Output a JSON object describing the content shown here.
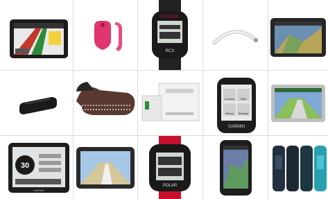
{
  "products": [
    {
      "id": "r1c1",
      "icon": "car-gps-navigator-icon",
      "kind": "device"
    },
    {
      "id": "r1c2",
      "icon": "clip-activity-tracker-icon",
      "kind": "device"
    },
    {
      "id": "r1c3",
      "icon": "sport-watch-icon",
      "kind": "device",
      "brand": "POLAR",
      "model": "RCX"
    },
    {
      "id": "r1c4",
      "icon": "headband-sensor-icon",
      "kind": "device"
    },
    {
      "id": "r1c5",
      "icon": "aviation-gps-icon",
      "kind": "device"
    },
    {
      "id": "r2c1",
      "icon": "usb-tracker-icon",
      "kind": "device"
    },
    {
      "id": "r2c2",
      "icon": "bluetooth-headset-icon",
      "kind": "device"
    },
    {
      "id": "r2c3",
      "icon": "lab-analyzer-icon",
      "kind": "device"
    },
    {
      "id": "r2c4",
      "icon": "bike-computer-icon",
      "kind": "device",
      "brand": "GARMIN",
      "menu": [
        "Courses",
        "Ride",
        "History",
        "Settings"
      ]
    },
    {
      "id": "r2c5",
      "icon": "car-gps-map-icon",
      "kind": "device"
    },
    {
      "id": "r3c1",
      "icon": "dashboard-gps-icon",
      "kind": "device",
      "speed": "30",
      "brand": "GARMIN"
    },
    {
      "id": "r3c2",
      "icon": "motorcycle-gps-icon",
      "kind": "device"
    },
    {
      "id": "r3c3",
      "icon": "red-sport-watch-icon",
      "kind": "device",
      "brand": "POLAR"
    },
    {
      "id": "r3c4",
      "icon": "handheld-gps-icon",
      "kind": "device"
    },
    {
      "id": "r3c5",
      "icon": "wristband-trackers-icon",
      "kind": "device"
    }
  ],
  "colors": {
    "divider": "#dcdcdc",
    "polar_red": "#c8102e",
    "pink": "#e0356e",
    "teal": "#2a9fb0"
  }
}
